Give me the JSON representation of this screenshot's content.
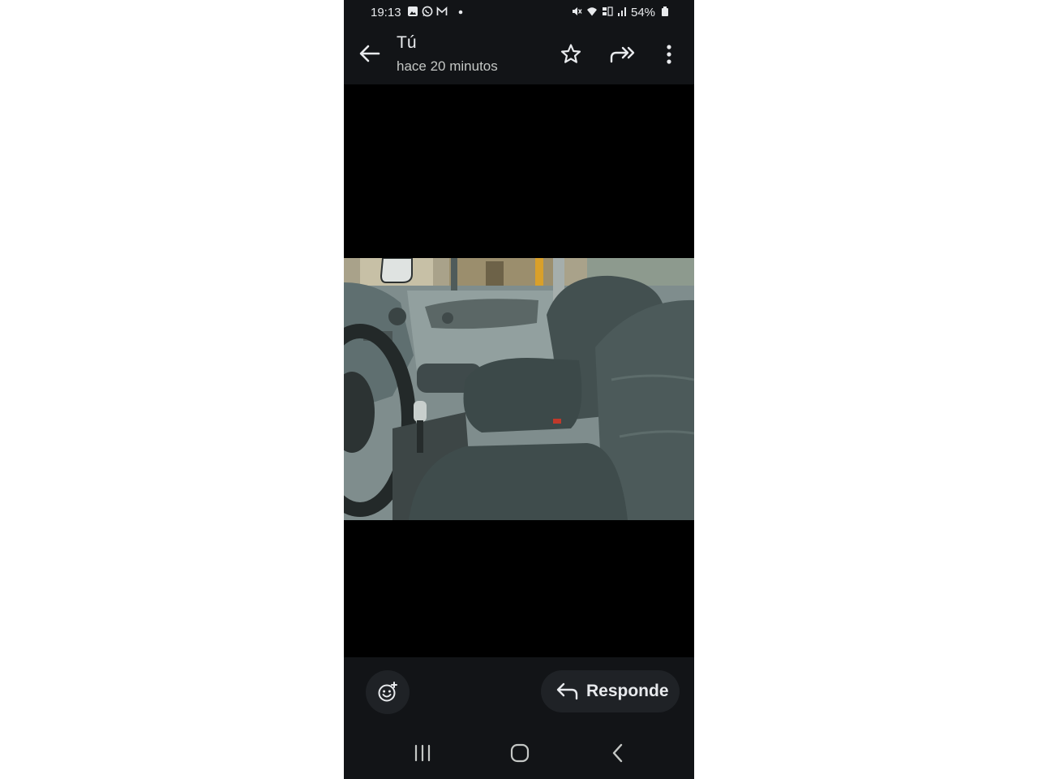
{
  "status_bar": {
    "time": "19:13",
    "battery": "54%",
    "left_icons": [
      "gallery-icon",
      "whatsapp-icon",
      "gmail-icon",
      "dot-icon"
    ],
    "right_icons": [
      "mute-icon",
      "wifi-icon",
      "volte-icon",
      "signal-icon",
      "battery-icon"
    ]
  },
  "header": {
    "sender": "Tú",
    "time_ago": "hace 20 minutos",
    "icons": [
      "back-arrow-icon",
      "star-icon",
      "forward-all-icon",
      "more-vert-icon"
    ]
  },
  "actions": {
    "reply_label": "Responde",
    "icons": [
      "add-reaction-icon",
      "reply-icon"
    ]
  },
  "nav": {
    "icons": [
      "recent-apps-icon",
      "home-icon",
      "back-icon"
    ]
  },
  "colors": {
    "background": "#121417",
    "viewer": "#000000",
    "text": "#e8eaed",
    "button_bg": "#1f2226"
  }
}
